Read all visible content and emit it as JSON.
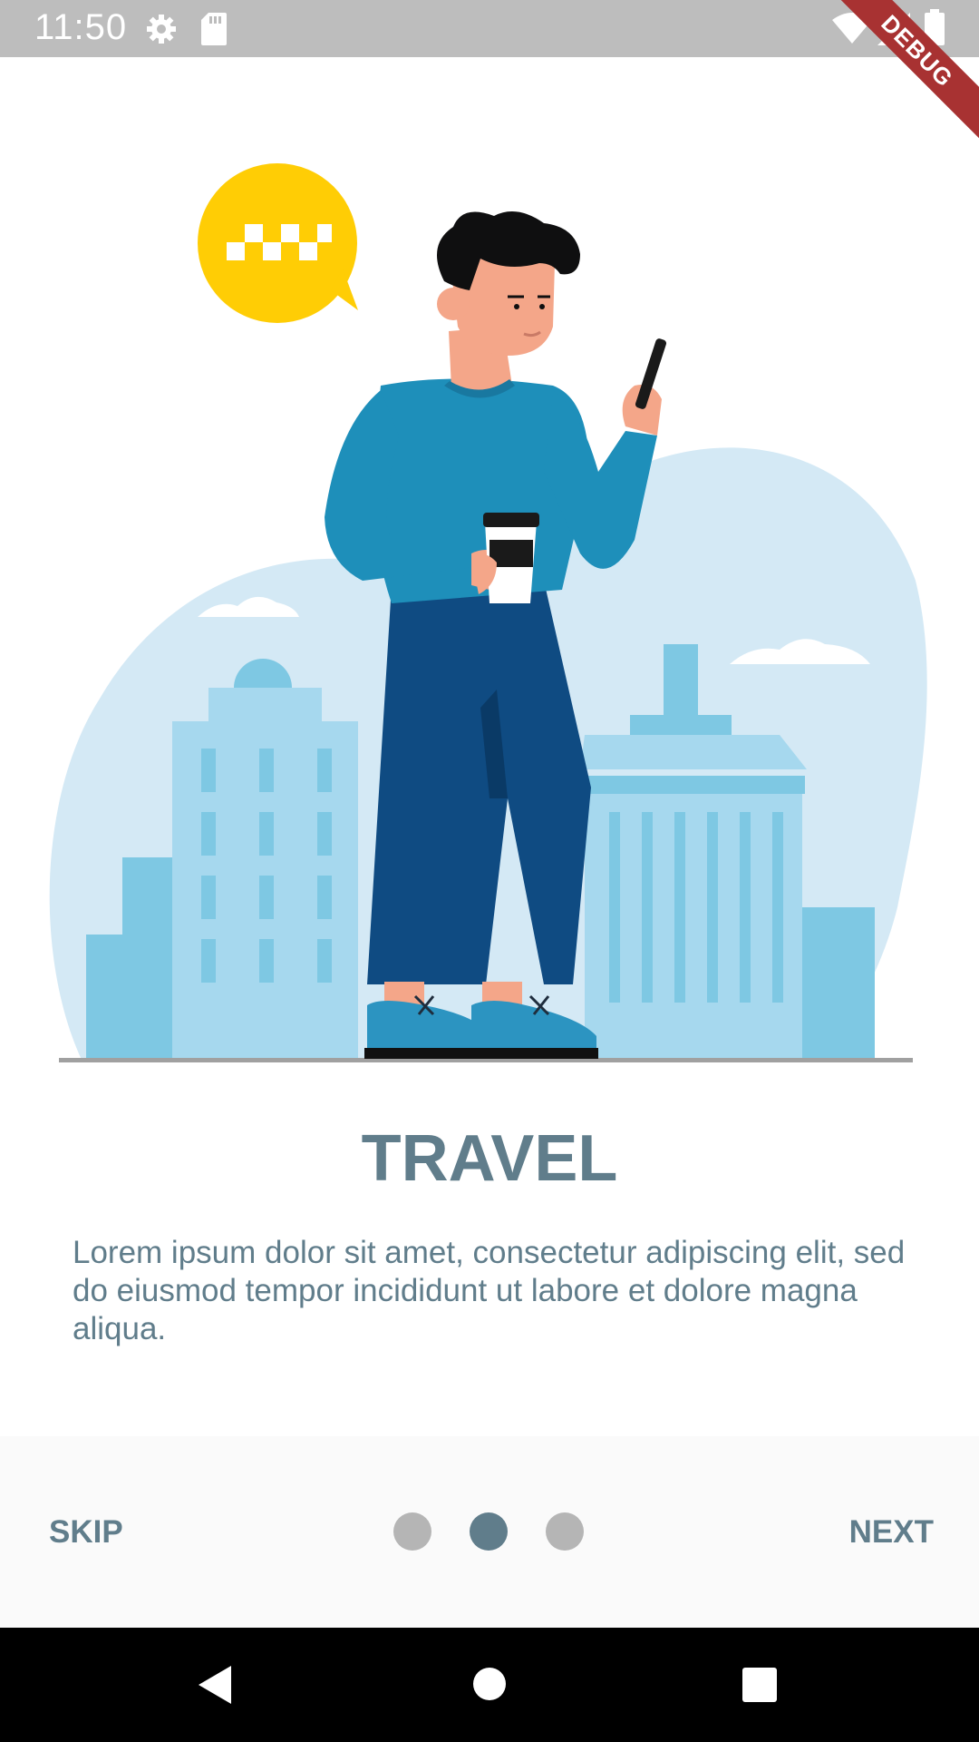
{
  "status_bar": {
    "time": "11:50",
    "icons": [
      "settings-icon",
      "sd-card-icon",
      "wifi-icon",
      "signal-icon",
      "battery-icon"
    ]
  },
  "debug_banner": {
    "label": "DEBUG"
  },
  "onboarding": {
    "illustration": "travel-illustration",
    "title": "TRAVEL",
    "description": "Lorem ipsum dolor sit amet, consectetur adipiscing elit, sed do eiusmod tempor incididunt ut labore et dolore magna aliqua."
  },
  "controls": {
    "skip_label": "SKIP",
    "next_label": "NEXT",
    "page_count": 3,
    "active_page": 1
  },
  "nav_bar": {
    "icons": [
      "back-icon",
      "home-icon",
      "recents-icon"
    ]
  },
  "colors": {
    "accent": "#607d8b",
    "inactive_dot": "#b5b5b5",
    "status_bar": "#bdbdbd",
    "debug_banner": "#a83232"
  }
}
